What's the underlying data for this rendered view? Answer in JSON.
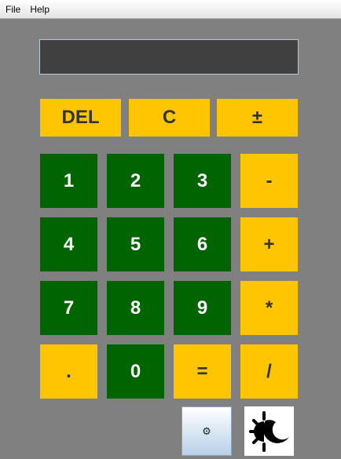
{
  "menu": {
    "file": "File",
    "help": "Help"
  },
  "display": {
    "value": ""
  },
  "controls": {
    "del": "DEL",
    "clear": "C",
    "negate": "±"
  },
  "keys": {
    "one": "1",
    "two": "2",
    "three": "3",
    "minus": "-",
    "four": "4",
    "five": "5",
    "six": "6",
    "plus": "+",
    "seven": "7",
    "eight": "8",
    "nine": "9",
    "multiply": "*",
    "dot": ".",
    "zero": "0",
    "equals": "=",
    "divide": "/"
  },
  "theme_button": {
    "icon": "⚙"
  },
  "mode_button": {
    "icon": "sun-moon-icon"
  },
  "colors": {
    "background": "#808080",
    "display": "#404040",
    "operator": "#ffc500",
    "digit": "#006400"
  }
}
